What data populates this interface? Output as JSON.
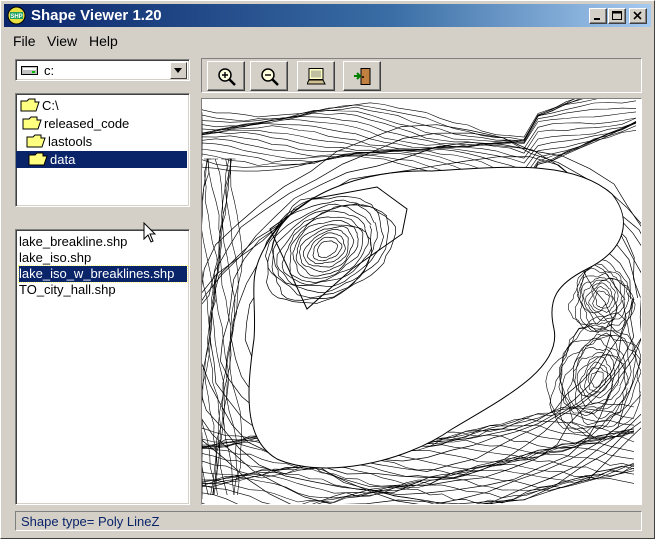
{
  "window": {
    "title": "Shape Viewer 1.20"
  },
  "menu": [
    {
      "label": "File"
    },
    {
      "label": "View"
    },
    {
      "label": "Help"
    }
  ],
  "drive": {
    "label": "c:"
  },
  "folders": [
    {
      "label": "C:\\"
    },
    {
      "label": "released_code"
    },
    {
      "label": "lastools"
    },
    {
      "label": "data",
      "selected": true
    }
  ],
  "files": [
    {
      "label": "lake_breakline.shp"
    },
    {
      "label": "lake_iso.shp"
    },
    {
      "label": "lake_iso_w_breaklines.shp",
      "selected": true
    },
    {
      "label": "TO_city_hall.shp"
    }
  ],
  "toolbar": [
    {
      "name": "zoom-in-button",
      "icon": "zoom-in-icon"
    },
    {
      "name": "zoom-out-button",
      "icon": "zoom-out-icon"
    },
    {
      "name": "fit-view-button",
      "icon": "monitor-icon"
    },
    {
      "name": "exit-button",
      "icon": "exit-door-icon"
    }
  ],
  "status": {
    "text": "Shape type= Poly LineZ"
  },
  "colors": {
    "titlebar": "#0a246a",
    "selection": "#0a246a",
    "face": "#d4d0c8"
  }
}
